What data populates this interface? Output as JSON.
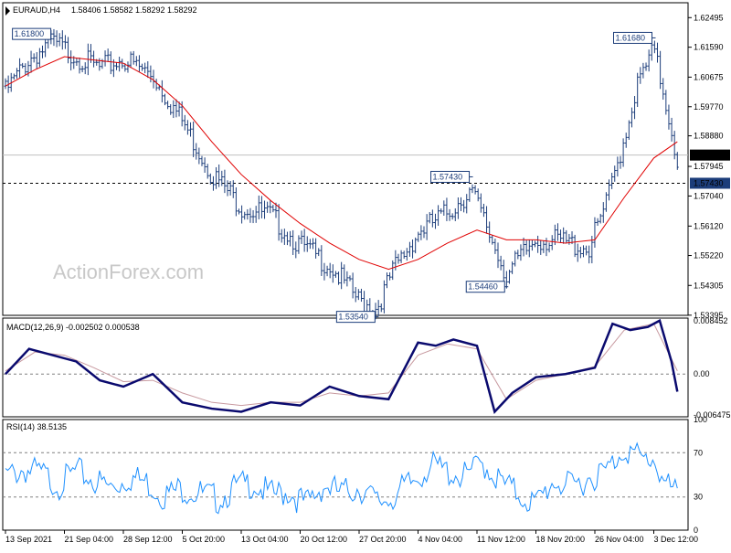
{
  "colors": {
    "bars": "#1c3d7a",
    "sma": "#e00000",
    "macd_main": "#0a0a6e",
    "macd_signal": "#c89aa0",
    "rsi": "#1e90ff",
    "grid_dash": "#808080",
    "current_price_line": "#c0c0c0",
    "label_bg_dark": "#1c3d7a"
  },
  "watermark": "ActionForex.com",
  "chart_data": [
    {
      "type": "line",
      "panel": "price",
      "header": {
        "symbol": "EURAUD,H4",
        "open": "1.58406",
        "high": "1.58582",
        "low": "1.58292",
        "close": "1.58292"
      },
      "ylim": [
        1.5339,
        1.6295
      ],
      "y_ticks": [
        "1.62495",
        "1.61590",
        "1.60675",
        "1.59770",
        "1.58880",
        "1.57945",
        "1.57040",
        "1.56120",
        "1.55220",
        "1.54305",
        "1.53395"
      ],
      "x_labels": [
        "13 Sep 2021",
        "21 Sep 04:00",
        "28 Sep 12:00",
        "5 Oct 20:00",
        "13 Oct 04:00",
        "20 Oct 12:00",
        "27 Oct 20:00",
        "4 Nov 04:00",
        "11 Nov 12:00",
        "18 Nov 20:00",
        "26 Nov 04:00",
        "3 Dec 12:00"
      ],
      "current_price_label": "1.58292",
      "horizontal_level": "1.57430",
      "annotations": [
        {
          "text": "1.61800",
          "at_index": 2
        },
        {
          "text": "1.53540",
          "at_index": 6
        },
        {
          "text": "1.57430",
          "at_index": 7
        },
        {
          "text": "1.54460",
          "at_index": 8
        },
        {
          "text": "1.61680",
          "at_index": 10
        }
      ],
      "series": [
        {
          "role": "close",
          "x": [
            0,
            0.4,
            0.8,
            1.2,
            1.6,
            2.0,
            2.5,
            3.0,
            3.5,
            4.0,
            4.5,
            5.0,
            5.5,
            6.0,
            6.3,
            6.6,
            7.0,
            7.5,
            7.9,
            8.2,
            8.5,
            9.0,
            9.5,
            9.9,
            10.2,
            10.5,
            10.7,
            11.0,
            11.25,
            11.4
          ],
          "values": [
            1.604,
            1.614,
            1.619,
            1.615,
            1.611,
            1.614,
            1.609,
            1.595,
            1.579,
            1.569,
            1.566,
            1.557,
            1.551,
            1.54,
            1.538,
            1.55,
            1.561,
            1.567,
            1.574,
            1.561,
            1.548,
            1.559,
            1.558,
            1.556,
            1.57,
            1.59,
            1.605,
            1.6168,
            1.597,
            1.583
          ]
        },
        {
          "role": "sma",
          "x": [
            0,
            0.5,
            1.0,
            1.5,
            2.0,
            2.5,
            3.0,
            3.5,
            4.0,
            4.5,
            5.0,
            5.5,
            6.0,
            6.5,
            7.0,
            7.5,
            8.0,
            8.5,
            9.0,
            9.5,
            10.0,
            10.5,
            11.0,
            11.4
          ],
          "values": [
            1.604,
            1.609,
            1.613,
            1.612,
            1.611,
            1.606,
            1.598,
            1.587,
            1.577,
            1.569,
            1.562,
            1.556,
            1.551,
            1.548,
            1.551,
            1.556,
            1.56,
            1.557,
            1.557,
            1.556,
            1.557,
            1.57,
            1.582,
            1.587
          ]
        }
      ]
    },
    {
      "type": "line",
      "panel": "macd",
      "header": "MACD(12,26,9) -0.002502 0.000538",
      "ylim": [
        -0.0068,
        0.0089
      ],
      "y_ticks": [
        "0.008452",
        "0.00",
        "-0.006475"
      ],
      "series": [
        {
          "role": "macd",
          "x": [
            0,
            0.4,
            0.8,
            1.2,
            1.6,
            2.0,
            2.5,
            3.0,
            3.5,
            4.0,
            4.5,
            5.0,
            5.5,
            6.0,
            6.5,
            7.0,
            7.3,
            7.6,
            8.0,
            8.3,
            8.6,
            9.0,
            9.5,
            10.0,
            10.3,
            10.6,
            10.9,
            11.1,
            11.3,
            11.4
          ],
          "values": [
            0.0,
            0.004,
            0.003,
            0.002,
            -0.001,
            -0.002,
            0.0,
            -0.0045,
            -0.0055,
            -0.006,
            -0.0045,
            -0.005,
            -0.002,
            -0.0035,
            -0.004,
            0.005,
            0.0045,
            0.0055,
            0.0045,
            -0.006,
            -0.003,
            -0.0005,
            0.0,
            0.001,
            0.008,
            0.007,
            0.0075,
            0.0085,
            0.002,
            -0.0028
          ]
        },
        {
          "role": "signal",
          "x": [
            0,
            0.5,
            1.0,
            1.5,
            2.0,
            2.5,
            3.0,
            3.5,
            4.0,
            4.5,
            5.0,
            5.5,
            6.0,
            6.5,
            7.0,
            7.5,
            8.0,
            8.5,
            9.0,
            9.5,
            10.0,
            10.5,
            11.0,
            11.4
          ],
          "values": [
            0.0005,
            0.0035,
            0.003,
            0.001,
            -0.0012,
            -0.001,
            -0.003,
            -0.0045,
            -0.005,
            -0.0045,
            -0.0045,
            -0.003,
            -0.0035,
            -0.003,
            0.003,
            0.0048,
            0.004,
            -0.004,
            -0.001,
            0.0,
            0.0012,
            0.007,
            0.008,
            0.0005
          ]
        }
      ]
    },
    {
      "type": "line",
      "panel": "rsi",
      "header": "RSI(14) 38.5135",
      "ylim": [
        0,
        100
      ],
      "y_ticks": [
        "100",
        "70",
        "30",
        "0"
      ],
      "levels": [
        70,
        30
      ],
      "series": [
        {
          "role": "rsi",
          "x": [
            0,
            0.3,
            0.6,
            0.9,
            1.2,
            1.5,
            1.8,
            2.1,
            2.4,
            2.7,
            3.0,
            3.3,
            3.6,
            3.9,
            4.2,
            4.5,
            4.8,
            5.1,
            5.4,
            5.7,
            6.0,
            6.3,
            6.6,
            6.9,
            7.2,
            7.5,
            7.8,
            8.1,
            8.4,
            8.7,
            9.0,
            9.3,
            9.6,
            9.9,
            10.2,
            10.5,
            10.8,
            11.0,
            11.2,
            11.4
          ],
          "values": [
            55,
            62,
            58,
            48,
            60,
            52,
            45,
            55,
            50,
            38,
            45,
            40,
            35,
            45,
            50,
            38,
            42,
            30,
            48,
            40,
            46,
            32,
            38,
            50,
            65,
            60,
            55,
            68,
            50,
            40,
            30,
            52,
            45,
            55,
            60,
            82,
            70,
            72,
            48,
            38.5
          ]
        }
      ]
    }
  ]
}
